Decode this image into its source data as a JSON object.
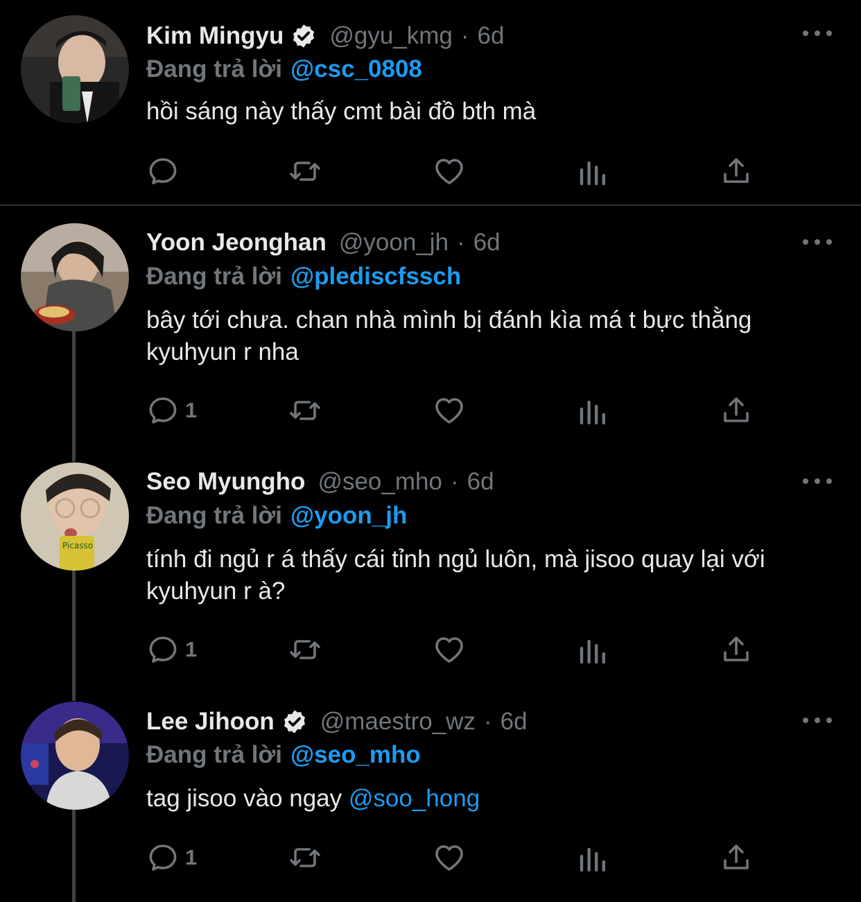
{
  "replying_label": "Đang trả lời",
  "colors": {
    "background": "#000000",
    "text": "#e7e9ea",
    "muted": "#71767b",
    "accent": "#1d9bf0",
    "divider": "#2f3336"
  },
  "icons": [
    "reply-icon",
    "retweet-icon",
    "like-icon",
    "analytics-icon",
    "share-icon",
    "more-icon",
    "verified-icon"
  ],
  "tweets": [
    {
      "name": "Kim Mingyu",
      "verified": true,
      "handle": "@gyu_kmg",
      "dot": "·",
      "time": "6d",
      "reply_to": "@csc_0808",
      "text_before": "hồi sáng này thấy cmt bài đồ bth mà",
      "mention": "",
      "reply_count": ""
    },
    {
      "name": "Yoon Jeonghan",
      "verified": false,
      "handle": "@yoon_jh",
      "dot": "·",
      "time": "6d",
      "reply_to": "@pledisc fssch",
      "text_before": "bây tới chưa. chan nhà mình bị đánh kìa má t bực thằng kyuhyun r nha",
      "mention": "",
      "reply_count": "1"
    },
    {
      "name": "Seo Myungho",
      "verified": false,
      "handle": "@seo_mho",
      "dot": "·",
      "time": "6d",
      "reply_to": "@yoon_jh",
      "text_before": "tính đi ngủ r á thấy cái tỉnh ngủ luôn, mà jisoo quay lại với kyuhyun r à?",
      "mention": "",
      "reply_count": "1"
    },
    {
      "name": "Lee Jihoon",
      "verified": true,
      "handle": "@maestro_wz",
      "dot": "·",
      "time": "6d",
      "reply_to": "@seo_mho",
      "text_before": "tag jisoo vào ngay ",
      "mention": "@soo_hong",
      "reply_count": "1"
    }
  ]
}
